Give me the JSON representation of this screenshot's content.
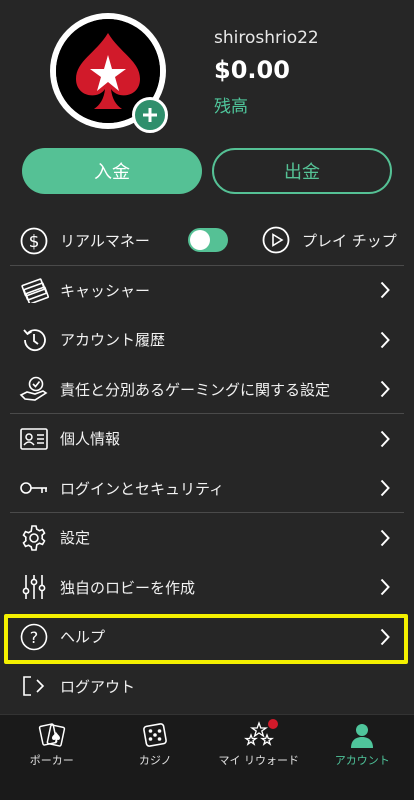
{
  "profile": {
    "username": "shiroshrio22",
    "balance": "$0.00",
    "balance_label": "残高"
  },
  "actions": {
    "deposit_label": "入金",
    "withdraw_label": "出金"
  },
  "currency_row": {
    "real_money_label": "リアルマネー",
    "toggle_on": true,
    "play_chips_label": "プレイ チップ"
  },
  "menu": {
    "items": [
      {
        "label": "キャッシャー",
        "icon": "cash-icon"
      },
      {
        "label": "アカウント履歴",
        "icon": "history-icon"
      },
      {
        "label": "責任と分別あるゲーミングに関する設定",
        "icon": "responsible-gaming-icon"
      },
      {
        "label": "個人情報",
        "icon": "id-card-icon"
      },
      {
        "label": "ログインとセキュリティ",
        "icon": "key-icon"
      },
      {
        "label": "設定",
        "icon": "gear-icon"
      },
      {
        "label": "独自のロビーを作成",
        "icon": "sliders-icon"
      },
      {
        "label": "ヘルプ",
        "icon": "help-icon"
      },
      {
        "label": "ログアウト",
        "icon": "logout-icon"
      }
    ]
  },
  "bottom_nav": {
    "items": [
      {
        "label": "ポーカー",
        "icon": "cards-icon"
      },
      {
        "label": "カジノ",
        "icon": "dice-icon"
      },
      {
        "label": "マイ リウォード",
        "icon": "stars-icon"
      },
      {
        "label": "アカウント",
        "icon": "person-icon"
      }
    ],
    "active": "アカウント"
  },
  "colors": {
    "accent": "#55c195",
    "background": "#262626",
    "highlight": "#f4f000",
    "brand_red": "#d11a2a"
  }
}
